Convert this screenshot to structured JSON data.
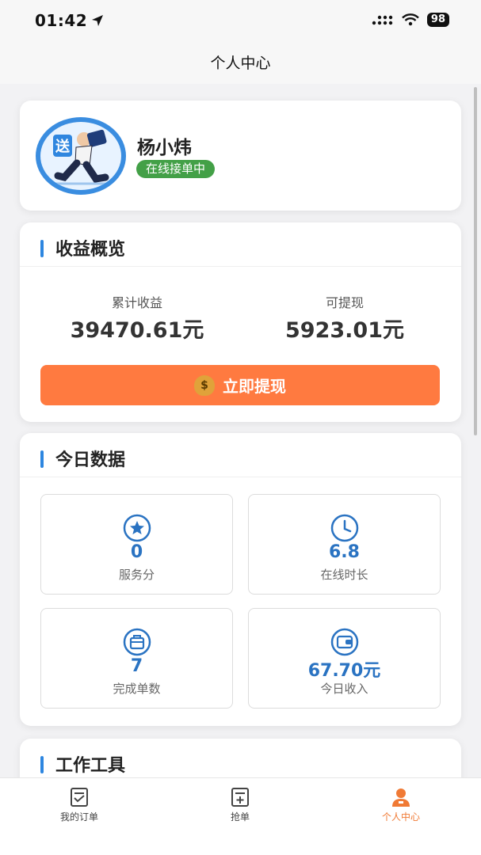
{
  "status_bar": {
    "time": "01:42",
    "battery": "98"
  },
  "nav": {
    "title": "个人中心"
  },
  "profile": {
    "name": "杨小炜",
    "status": "在线接单中",
    "avatar_badge": "送"
  },
  "earnings": {
    "title": "收益概览",
    "total_label": "累计收益",
    "total_value": "39470.61元",
    "available_label": "可提现",
    "available_value": "5923.01元",
    "withdraw_label": "立即提现"
  },
  "today": {
    "title": "今日数据",
    "stats": [
      {
        "icon": "star-icon",
        "value": "0",
        "label": "服务分"
      },
      {
        "icon": "clock-icon",
        "value": "6.8",
        "label": "在线时长"
      },
      {
        "icon": "bag-icon",
        "value": "7",
        "label": "完成单数"
      },
      {
        "icon": "wallet-icon",
        "value": "67.70元",
        "label": "今日收入"
      }
    ]
  },
  "tools": {
    "title": "工作工具"
  },
  "tabs": [
    {
      "label": "我的订单",
      "icon": "orders-icon"
    },
    {
      "label": "抢单",
      "icon": "grab-order-icon"
    },
    {
      "label": "个人中心",
      "icon": "profile-icon",
      "active": true
    }
  ],
  "colors": {
    "accent": "#2d86e0",
    "withdraw": "#ff7a40",
    "online": "#43a047",
    "active_tab": "#f07a35"
  }
}
